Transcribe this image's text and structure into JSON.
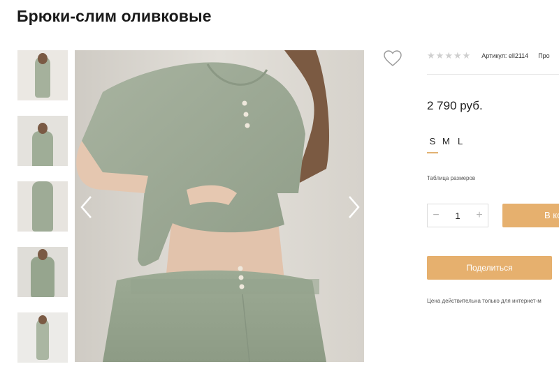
{
  "product": {
    "title": "Брюки-слим оливковые",
    "price": "2 790 руб.",
    "article": "Артикул: ell2114",
    "extra_meta": "Про",
    "rating": 0,
    "rating_max": 5
  },
  "sizes": [
    {
      "label": "S",
      "selected": true
    },
    {
      "label": "M",
      "selected": false
    },
    {
      "label": "L",
      "selected": false
    }
  ],
  "size_table_link": "Таблица размеров",
  "quantity": {
    "value": "1",
    "minus": "−",
    "plus": "+"
  },
  "cart_button": "В ко",
  "share_button": "Поделиться",
  "price_note": "Цена действительна только для интернет-м",
  "gallery": {
    "thumbnail_count": 5,
    "prev_icon": "chevron-left-icon",
    "next_icon": "chevron-right-icon",
    "favorite_icon": "heart-icon"
  },
  "colors": {
    "accent": "#e6b06e",
    "olive": "#9aa891",
    "star_empty": "#cfcfcf"
  }
}
